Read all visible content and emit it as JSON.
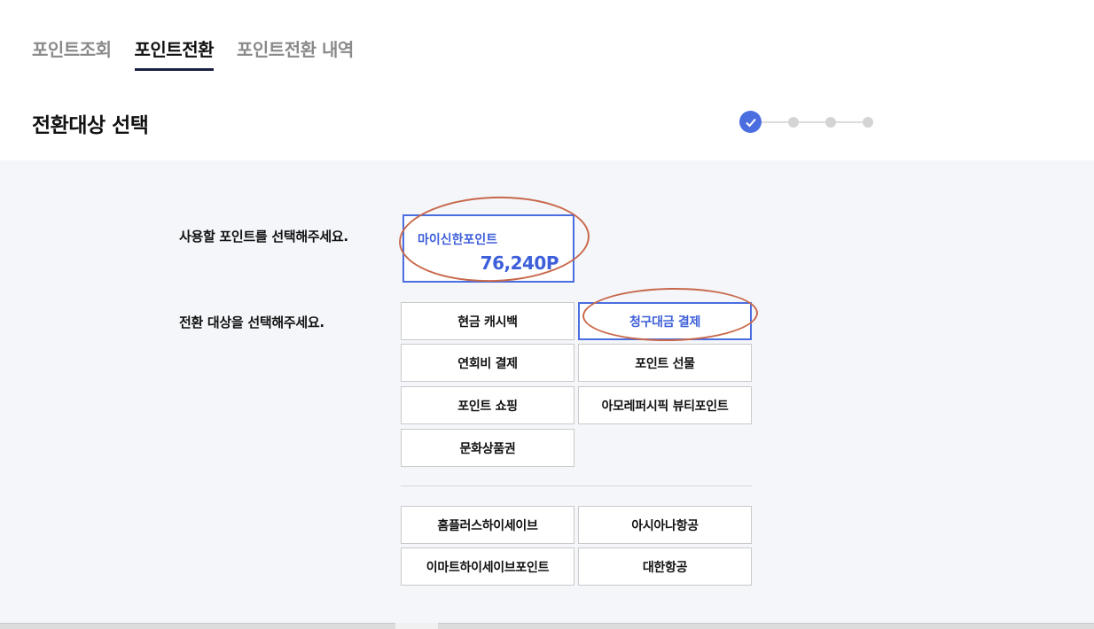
{
  "tabs": [
    {
      "label": "포인트조회",
      "active": false
    },
    {
      "label": "포인트전환",
      "active": true
    },
    {
      "label": "포인트전환 내역",
      "active": false
    }
  ],
  "header": {
    "title": "전환대상 선택"
  },
  "stepper": {
    "total_steps": 4,
    "current_step": 1
  },
  "labels": {
    "select_point": "사용할 포인트를 선택해주세요.",
    "select_target": "전환 대상을 선택해주세요."
  },
  "point_card": {
    "name": "마이신한포인트",
    "value": "76,240P"
  },
  "targets": [
    {
      "label": "현금 캐시백",
      "selected": false
    },
    {
      "label": "청구대금 결제",
      "selected": true
    },
    {
      "label": "연회비 결제",
      "selected": false
    },
    {
      "label": "포인트 선물",
      "selected": false
    },
    {
      "label": "포인트 쇼핑",
      "selected": false
    },
    {
      "label": "아모레퍼시픽 뷰티포인트",
      "selected": false
    },
    {
      "label": "문화상품권",
      "selected": false
    }
  ],
  "partners": [
    {
      "label": "홈플러스하이세이브"
    },
    {
      "label": "아시아나항공"
    },
    {
      "label": "이마트하이세이브포인트"
    },
    {
      "label": "대한항공"
    }
  ],
  "colors": {
    "accent": "#4a6ee0",
    "accent_text": "#3d5fd9",
    "annotation": "#c8684a",
    "content_bg": "#f4f6fa"
  }
}
